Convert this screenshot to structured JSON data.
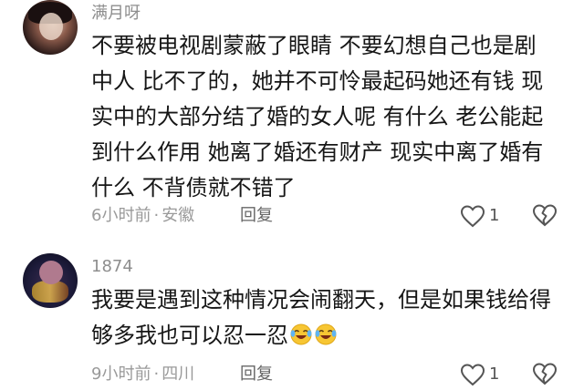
{
  "comments": [
    {
      "username": "满月呀",
      "lines": [
        "不要被电视剧蒙蔽了眼睛 不要幻想自己也是剧",
        "中人 比不了的，她并不可怜最起码她还有钱 现",
        "实中的大部分结了婚的女人呢 有什么 老公能起",
        "到什么作用 她离了婚还有财产 现实中离了婚有",
        "什么 不背债就不错了"
      ],
      "time": "6小时前",
      "separator": "·",
      "location": "安徽",
      "reply_label": "回复",
      "like_count": "1"
    },
    {
      "username": "1874",
      "lines": [
        "我要是遇到这种情况会闹翻天，但是如果钱给得",
        "够多我也可以忍一忍"
      ],
      "emoji": [
        "laughing-tears-emoji",
        "laughing-tears-emoji"
      ],
      "time": "9小时前",
      "separator": "·",
      "location": "四川",
      "reply_label": "回复",
      "like_count": "1"
    }
  ],
  "colors": {
    "username": "#8e8e8e",
    "body": "#161616",
    "meta": "#9a9a9a",
    "icon": "#555555"
  }
}
